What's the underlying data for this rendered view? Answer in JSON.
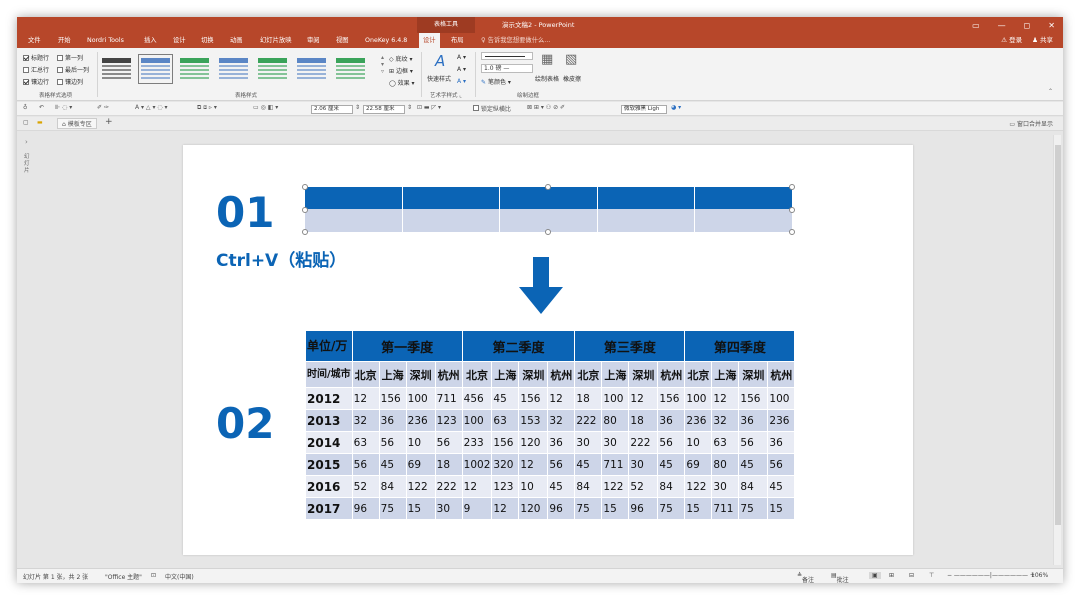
{
  "window": {
    "context_group": "表格工具",
    "doc_title": "演示文稿2 - PowerPoint",
    "controls": [
      "▭",
      "—",
      "◻",
      "✕"
    ]
  },
  "tabs": [
    "文件",
    "开始",
    "Nordri Tools",
    "插入",
    "设计",
    "切换",
    "动画",
    "幻灯片放映",
    "审阅",
    "视图",
    "OneKey 6.4.8",
    "设计",
    "布局"
  ],
  "tell_me": "告诉我您想要做什么...",
  "user": {
    "login": "登录",
    "share": "共享"
  },
  "ribbon": {
    "options": [
      {
        "label": "标题行",
        "checked": true
      },
      {
        "label": "第一列",
        "checked": false
      },
      {
        "label": "汇总行",
        "checked": false
      },
      {
        "label": "最后一列",
        "checked": false
      },
      {
        "label": "镶边行",
        "checked": true
      },
      {
        "label": "镶边列",
        "checked": false
      }
    ],
    "group_labels": [
      "表格样式选项",
      "表格样式",
      "艺术字样式",
      "绘制边框"
    ],
    "shading": "底纹",
    "border": "边框",
    "effect": "效果",
    "quick_styles": "快速样式",
    "pen_weight": "1.0 磅",
    "pen_color": "笔颜色",
    "draw_table": "绘制表格",
    "eraser": "橡皮擦",
    "style_colors": [
      "#444444",
      "#5b86c5",
      "#3aa35a",
      "#5b86c5",
      "#3aa35a",
      "#5b86c5",
      "#3aa35a"
    ]
  },
  "toolbar": {
    "height_val": "2.06 厘米",
    "width_val": "22.58 厘米",
    "lock_ratio": "锁定纵横比",
    "font": "微软雅黑 Ligh"
  },
  "doc_tabs": {
    "template": "模板专区",
    "merge": "窗口合并显示"
  },
  "left_pane": "幻灯片",
  "slide": {
    "num1": "01",
    "num2": "02",
    "ctrlv": "Ctrl+V（粘贴）",
    "unit_header": "单位/万",
    "time_city": "时间/城市",
    "quarters": [
      "第一季度",
      "第二季度",
      "第三季度",
      "第四季度"
    ],
    "cities": [
      "北京",
      "上海",
      "深圳",
      "杭州"
    ],
    "rows": [
      {
        "year": "2012",
        "values": [
          "12",
          "156",
          "100",
          "711",
          "456",
          "45",
          "156",
          "12",
          "18",
          "100",
          "12",
          "156",
          "100",
          "12",
          "156",
          "100"
        ]
      },
      {
        "year": "2013",
        "values": [
          "32",
          "36",
          "236",
          "123",
          "100",
          "63",
          "153",
          "32",
          "222",
          "80",
          "18",
          "36",
          "236",
          "32",
          "36",
          "236"
        ]
      },
      {
        "year": "2014",
        "values": [
          "63",
          "56",
          "10",
          "56",
          "233",
          "156",
          "120",
          "36",
          "30",
          "30",
          "222",
          "56",
          "10",
          "63",
          "56",
          "36"
        ]
      },
      {
        "year": "2015",
        "values": [
          "56",
          "45",
          "69",
          "18",
          "1002",
          "320",
          "12",
          "56",
          "45",
          "711",
          "30",
          "45",
          "69",
          "80",
          "45",
          "56"
        ]
      },
      {
        "year": "2016",
        "values": [
          "52",
          "84",
          "122",
          "222",
          "12",
          "123",
          "10",
          "45",
          "84",
          "122",
          "52",
          "84",
          "122",
          "30",
          "84",
          "45"
        ]
      },
      {
        "year": "2017",
        "values": [
          "96",
          "75",
          "15",
          "30",
          "9",
          "12",
          "120",
          "96",
          "75",
          "15",
          "96",
          "75",
          "15",
          "711",
          "75",
          "15"
        ]
      }
    ],
    "colors": {
      "accent": "#0b64b5",
      "band_dark": "#cdd5e8",
      "band_light": "#e8ebf4"
    }
  },
  "status": {
    "slide_info": "幻灯片 第 1 张，共 2 张",
    "theme": "\"Office 主题\"",
    "lang": "中文(中国)",
    "notes": "备注",
    "comments": "批注",
    "zoom": "106%"
  }
}
